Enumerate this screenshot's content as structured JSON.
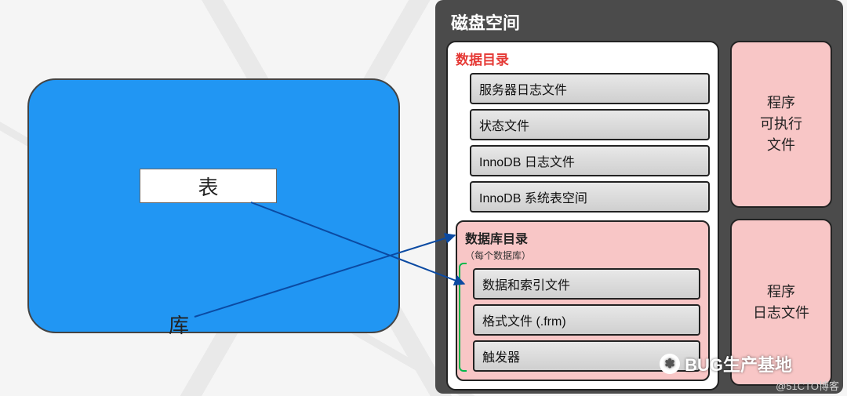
{
  "left": {
    "table_label": "表",
    "db_label": "库"
  },
  "disk": {
    "title": "磁盘空间",
    "data_dir_title": "数据目录",
    "items": {
      "i0": "服务器日志文件",
      "i1": "状态文件",
      "i2": "InnoDB 日志文件",
      "i3": "InnoDB 系统表空间"
    },
    "db_dir": {
      "title": "数据库目录",
      "subtitle": "（每个数据库）",
      "d0": "数据和索引文件",
      "d1": "格式文件 (.frm)",
      "d2": "触发器"
    },
    "exec_box": "程序\n可执行\n文件",
    "log_box": "程序\n日志文件"
  },
  "watermark": {
    "brand": "BUG生产基地",
    "site": "@51CTO博客"
  }
}
